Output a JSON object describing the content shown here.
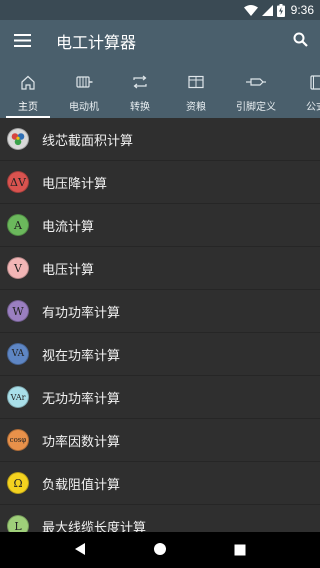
{
  "status_bar": {
    "time": "9:36"
  },
  "app_bar": {
    "title": "电工计算器"
  },
  "tabs": [
    {
      "label": "主页",
      "icon": "home-icon",
      "active": true
    },
    {
      "label": "电动机",
      "icon": "motor-icon",
      "active": false
    },
    {
      "label": "转换",
      "icon": "convert-icon",
      "active": false
    },
    {
      "label": "资粮",
      "icon": "resource-icon",
      "active": false
    },
    {
      "label": "引脚定义",
      "icon": "pin-icon",
      "active": false
    },
    {
      "label": "公式",
      "icon": "book-icon",
      "active": false
    }
  ],
  "list": [
    {
      "label": "线芯截面积计算",
      "badge": "",
      "badge_color": "#c9c9c9",
      "icon": "wire-section-icon"
    },
    {
      "label": "电压降计算",
      "badge": "ΔV",
      "badge_color": "#d9534f",
      "icon": "voltage-drop-icon"
    },
    {
      "label": "电流计算",
      "badge": "A",
      "badge_color": "#6bb85c",
      "icon": "current-icon"
    },
    {
      "label": "电压计算",
      "badge": "V",
      "badge_color": "#f2b6b6",
      "icon": "voltage-icon"
    },
    {
      "label": "有功功率计算",
      "badge": "W",
      "badge_color": "#9a7fc0",
      "icon": "active-power-icon"
    },
    {
      "label": "视在功率计算",
      "badge": "VA",
      "badge_color": "#5e86c4",
      "icon": "apparent-power-icon"
    },
    {
      "label": "无功功率计算",
      "badge": "VAr",
      "badge_color": "#a9dfe9",
      "icon": "reactive-power-icon"
    },
    {
      "label": "功率因数计算",
      "badge": "cosφ",
      "badge_color": "#e8914a",
      "icon": "power-factor-icon"
    },
    {
      "label": "负载阻值计算",
      "badge": "Ω",
      "badge_color": "#f4d21f",
      "icon": "load-resistance-icon"
    },
    {
      "label": "最大线缆长度计算",
      "badge": "L",
      "badge_color": "#9fcf7a",
      "icon": "cable-length-icon"
    }
  ]
}
